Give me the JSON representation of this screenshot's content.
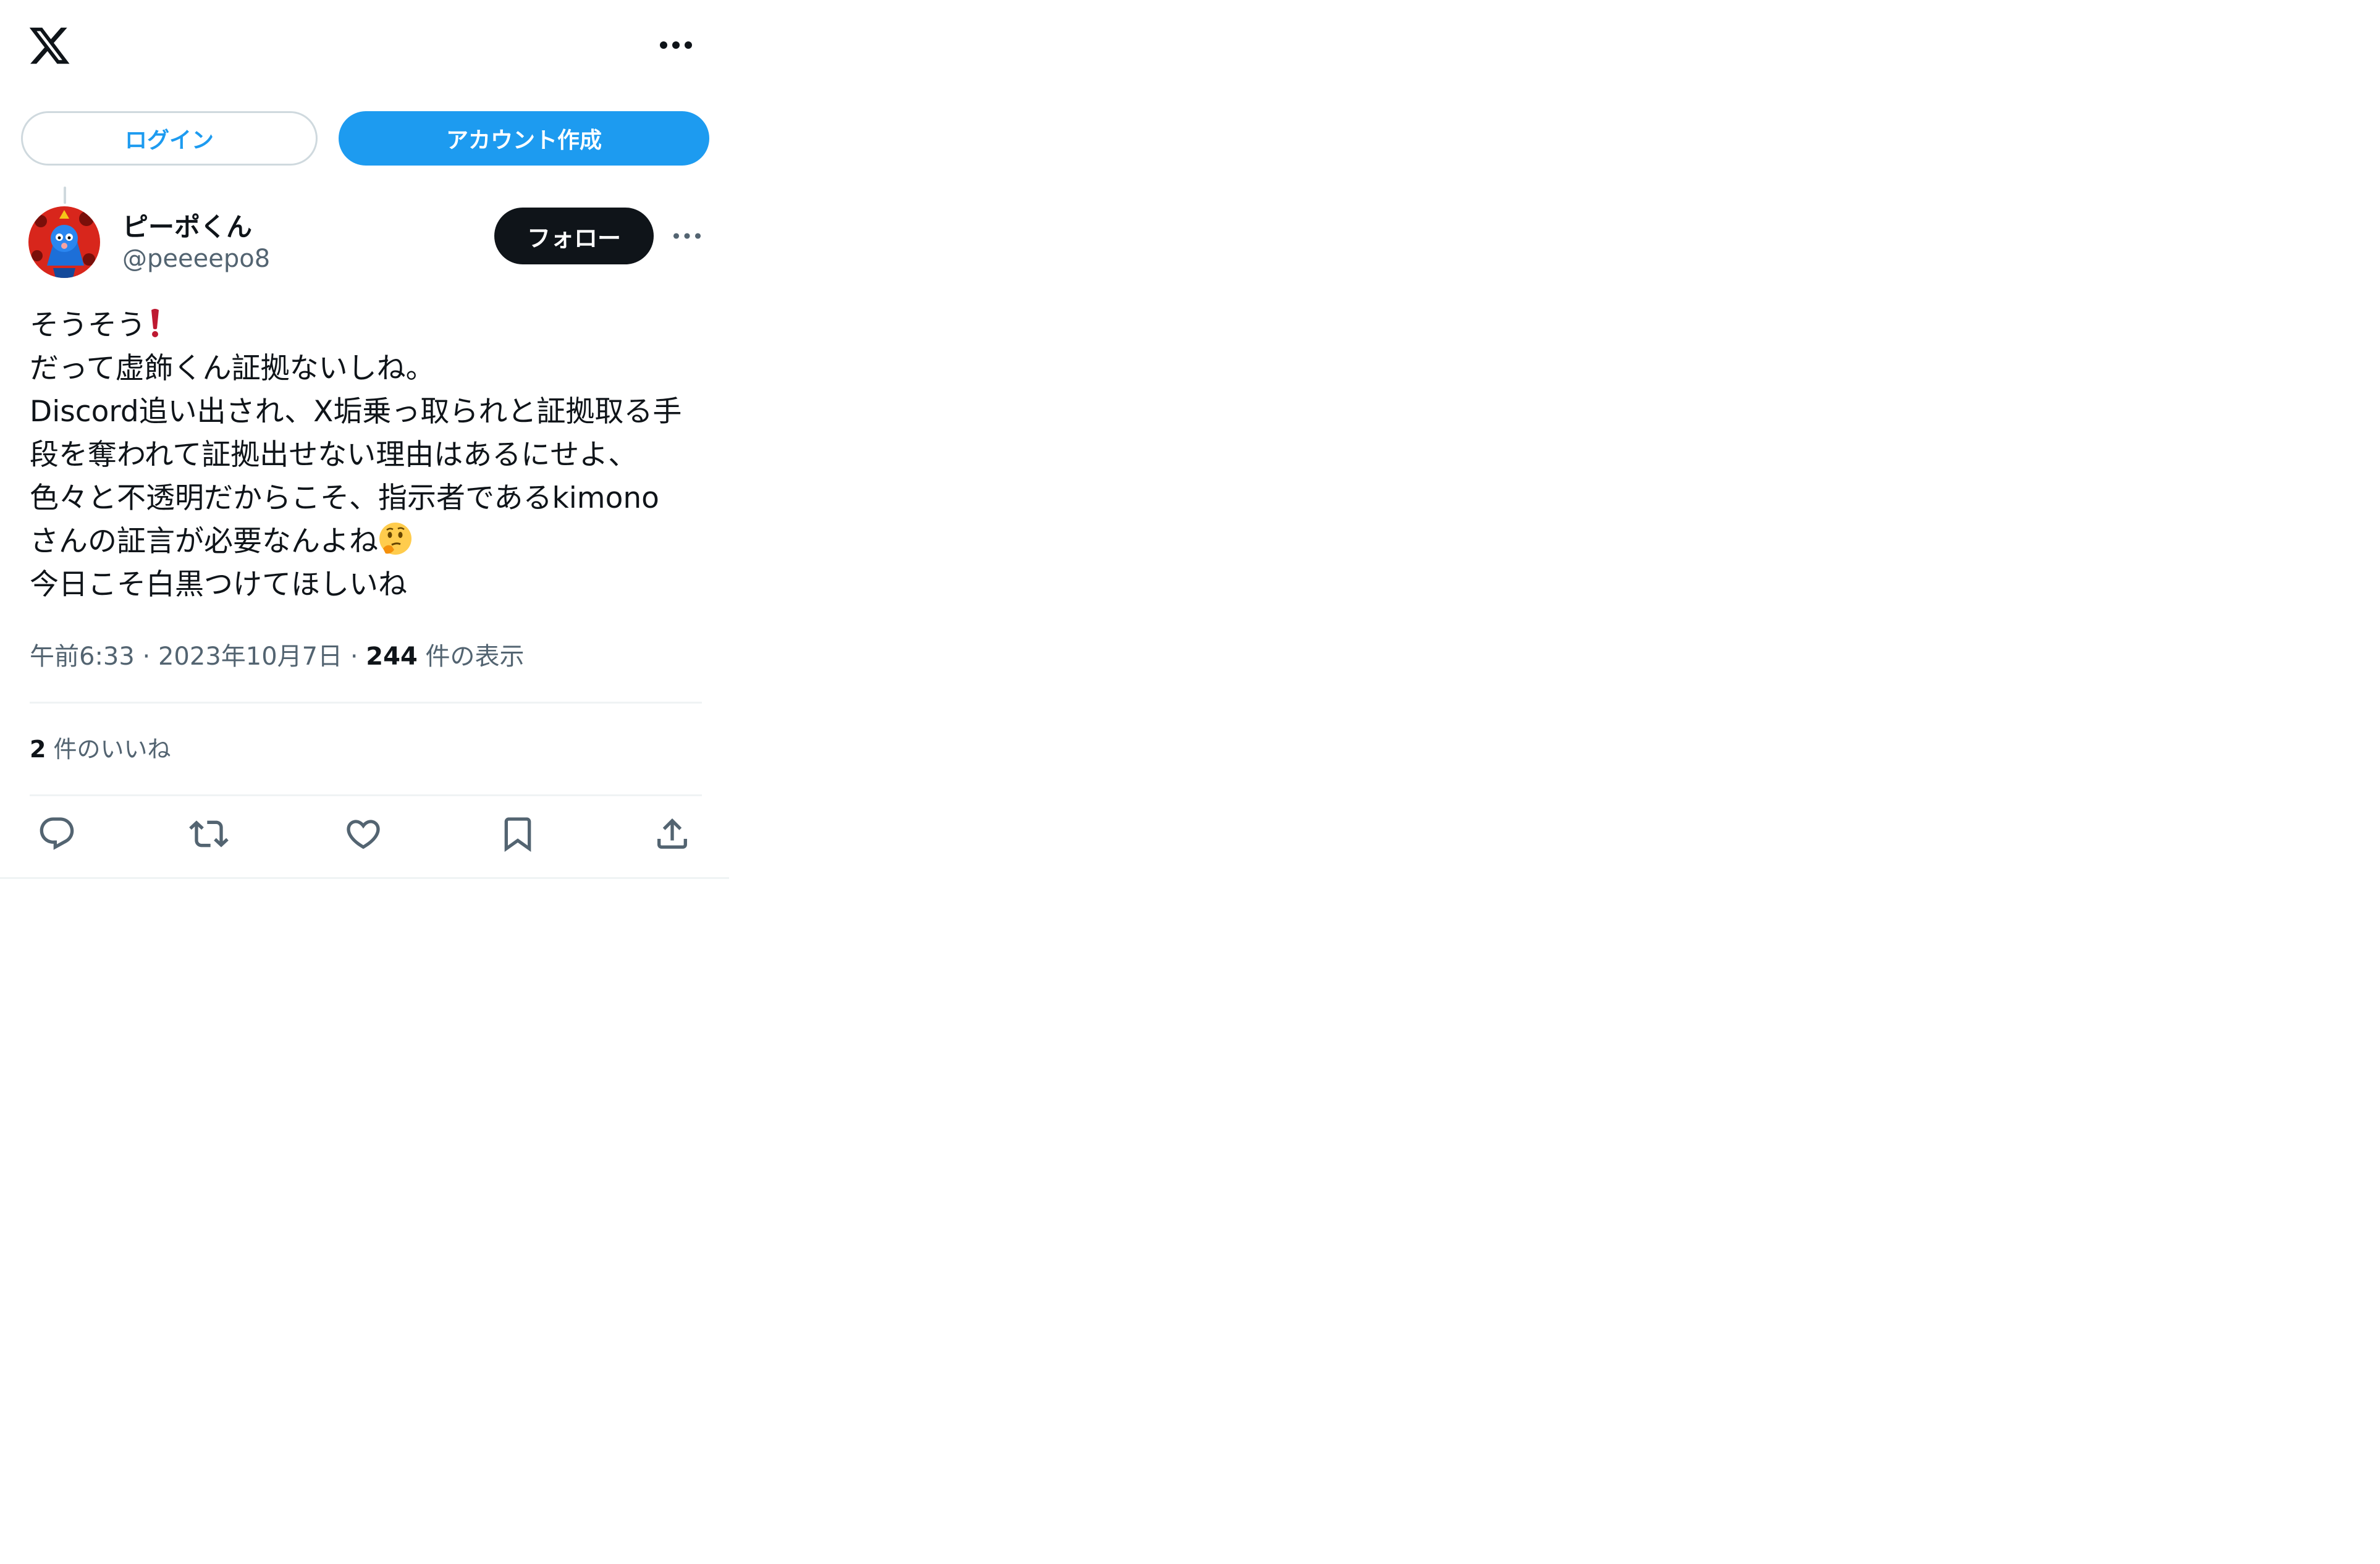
{
  "header": {
    "logo_icon": "x-logo-icon",
    "more_icon": "more-horizontal-icon"
  },
  "auth": {
    "login_label": "ログイン",
    "signup_label": "アカウント作成"
  },
  "post": {
    "author_name": "ピーポくん",
    "author_handle": "@peeeepo8",
    "follow_label": "フォロー",
    "lines": [
      "そうそう",
      "だって虚飾くん証拠ないしね。",
      "Discord追い出され、X垢乗っ取られと証拠取る手",
      "段を奪われて証拠出せない理由はあるにせよ、",
      "色々と不透明だからこそ、指示者であるkimono",
      "さんの証言が必要なんよね",
      "今日こそ白黒つけてほしいね"
    ],
    "emoji": {
      "line1": "exclamation-mark-emoji",
      "line6": "thinking-face-emoji"
    },
    "time": "午前6:33",
    "date": "2023年10月7日",
    "separator": "·",
    "views_count": "244",
    "views_label": "件の表示",
    "likes_count": "2",
    "likes_label": "件のいいね"
  },
  "actions": [
    "reply-icon",
    "repost-icon",
    "like-icon",
    "bookmark-icon",
    "share-icon"
  ],
  "colors": {
    "accent": "#1d9bf0",
    "text": "#0f1419",
    "secondary": "#536471",
    "border": "#eff3f4"
  }
}
